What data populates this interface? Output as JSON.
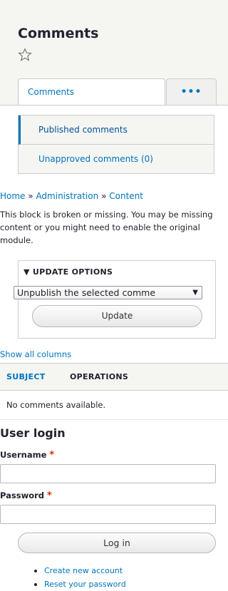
{
  "header": {
    "title": "Comments",
    "tabs": [
      {
        "label": "Comments"
      },
      {
        "label": "•••"
      }
    ]
  },
  "subtabs": [
    {
      "label": "Published comments"
    },
    {
      "label": "Unapproved comments (0)"
    }
  ],
  "breadcrumb": {
    "home": "Home",
    "administration": "Administration",
    "content": "Content",
    "separator": "»"
  },
  "message": "This block is broken or missing. You may be missing content or you might need to enable the original module.",
  "update_options": {
    "summary": "▼ UPDATE OPTIONS",
    "select_value": "Unpublish the selected comme",
    "update_label": "Update"
  },
  "table": {
    "show_all_columns": "Show all columns",
    "headers": [
      "SUBJECT",
      "OPERATIONS"
    ],
    "empty": "No comments available."
  },
  "login": {
    "title": "User login",
    "username_label": "Username",
    "password_label": "Password",
    "required_mark": "*",
    "submit_label": "Log in",
    "links": [
      "Create new account",
      "Reset your password"
    ]
  },
  "colors": {
    "link": "#0074bd",
    "required": "#e62600",
    "header_bg": "#f5f5f2"
  }
}
